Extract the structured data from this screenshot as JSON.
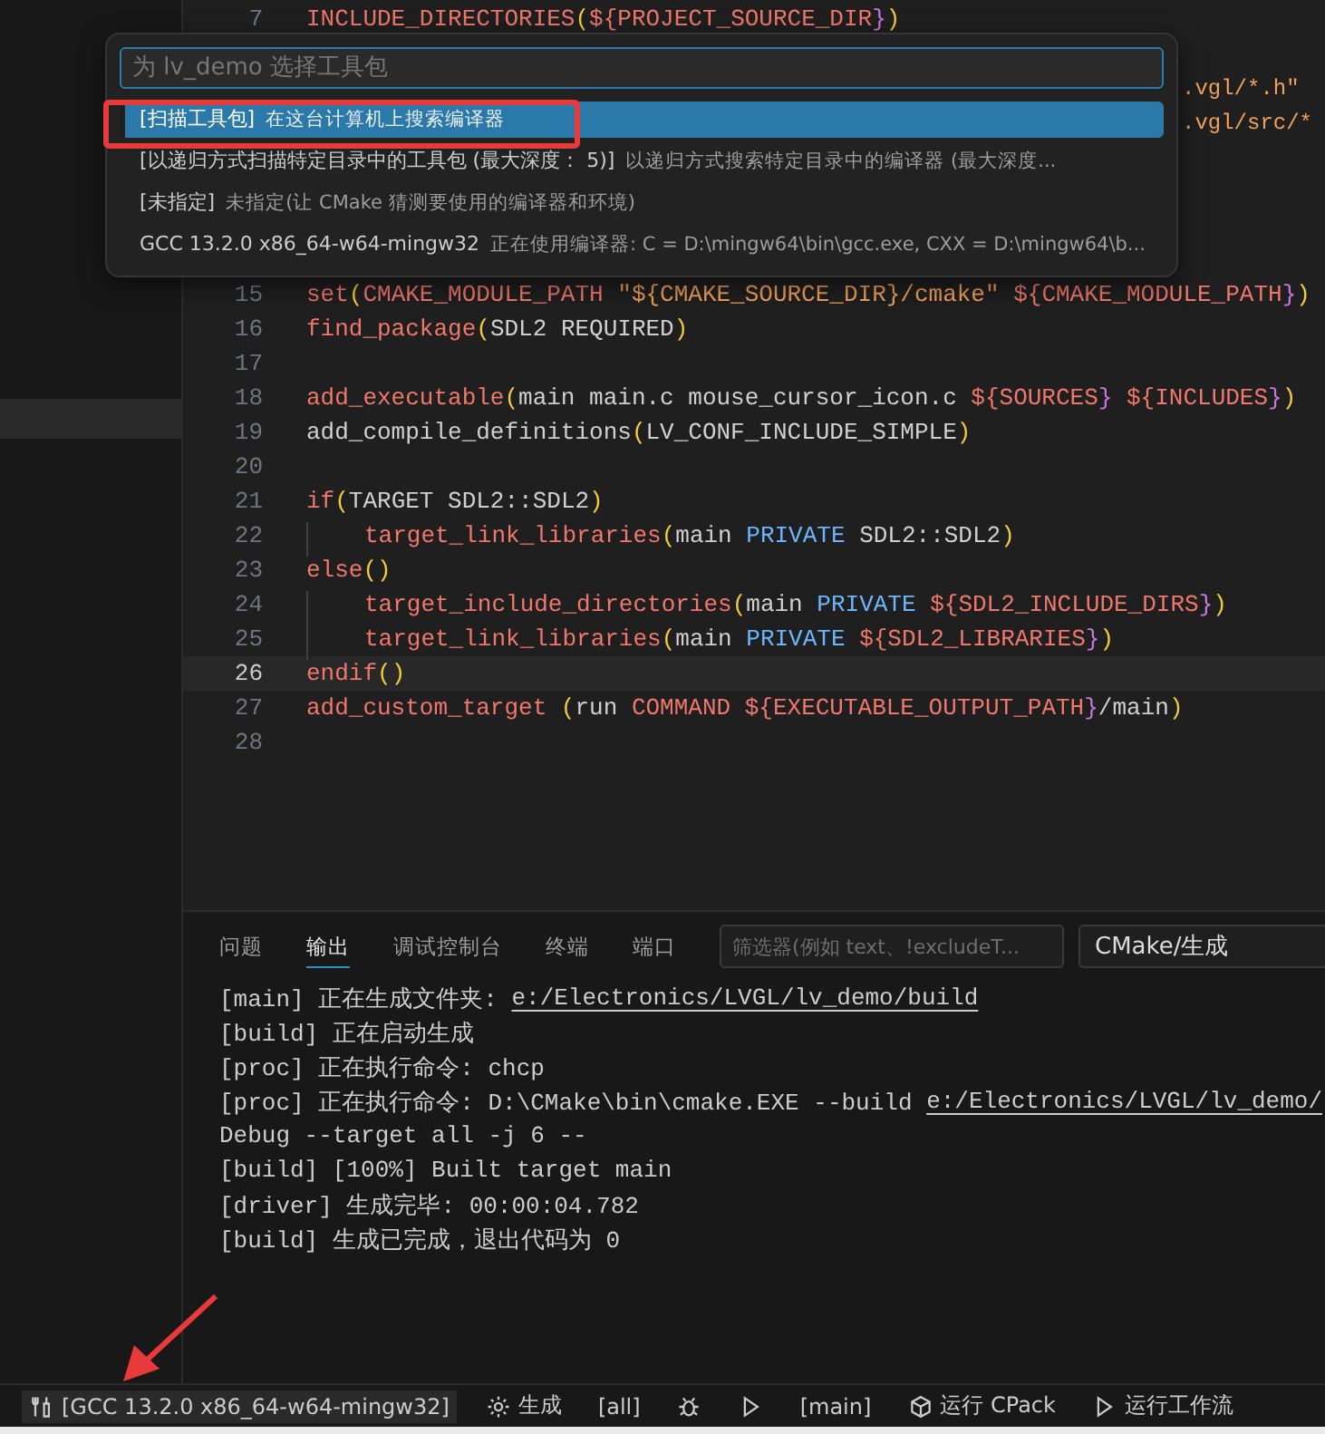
{
  "editor": {
    "lines": [
      {
        "kind": "code",
        "number": "7",
        "current": false,
        "tokens": [
          {
            "kind": "fn",
            "text": "INCLUDE_DIRECTORIES"
          },
          {
            "kind": "paren",
            "text": "("
          },
          {
            "kind": "var",
            "text": "${"
          },
          {
            "kind": "var",
            "text": "PROJECT_SOURCE_DIR"
          },
          {
            "kind": "brace",
            "text": "}"
          },
          {
            "kind": "paren",
            "text": ")"
          }
        ]
      },
      {
        "kind": "covered"
      },
      {
        "kind": "covered",
        "tokens": [
          {
            "kind": "str",
            "text": ".vgl/*.h\""
          }
        ]
      },
      {
        "kind": "covered",
        "tokens": [
          {
            "kind": "str",
            "text": ".vgl/src/*"
          }
        ]
      },
      {
        "kind": "covered"
      },
      {
        "kind": "covered"
      },
      {
        "kind": "covered"
      },
      {
        "kind": "covered"
      },
      {
        "kind": "code",
        "number": "15",
        "current": false,
        "tokens": [
          {
            "kind": "fn",
            "text": "set"
          },
          {
            "kind": "paren",
            "text": "("
          },
          {
            "kind": "fn",
            "text": "CMAKE_MODULE_PATH"
          },
          {
            "kind": "str",
            "text": " \"${CMAKE_SOURCE_DIR}/cmake\""
          },
          {
            "kind": "var",
            "text": " ${"
          },
          {
            "kind": "var",
            "text": "CMAKE_MODULE_PATH"
          },
          {
            "kind": "brace",
            "text": "}"
          },
          {
            "kind": "paren",
            "text": ")"
          }
        ]
      },
      {
        "kind": "code",
        "number": "16",
        "current": false,
        "tokens": [
          {
            "kind": "fn",
            "text": "find_package"
          },
          {
            "kind": "paren",
            "text": "("
          },
          {
            "kind": "plain",
            "text": "SDL2 REQUIRED"
          },
          {
            "kind": "paren",
            "text": ")"
          }
        ]
      },
      {
        "kind": "code",
        "number": "17",
        "current": false
      },
      {
        "kind": "code",
        "number": "18",
        "current": false,
        "tokens": [
          {
            "kind": "fn",
            "text": "add_executable"
          },
          {
            "kind": "paren",
            "text": "("
          },
          {
            "kind": "plain",
            "text": "main main.c mouse_cursor_icon.c "
          },
          {
            "kind": "var",
            "text": "${"
          },
          {
            "kind": "var",
            "text": "SOURCES"
          },
          {
            "kind": "brace",
            "text": "}"
          },
          {
            "kind": "var",
            "text": " ${"
          },
          {
            "kind": "var",
            "text": "INCLUDES"
          },
          {
            "kind": "brace",
            "text": "}"
          },
          {
            "kind": "paren",
            "text": ")"
          }
        ]
      },
      {
        "kind": "code",
        "number": "19",
        "current": false,
        "tokens": [
          {
            "kind": "plain",
            "text": "add_compile_definitions"
          },
          {
            "kind": "paren",
            "text": "("
          },
          {
            "kind": "plain",
            "text": "LV_CONF_INCLUDE_SIMPLE"
          },
          {
            "kind": "paren",
            "text": ")"
          }
        ]
      },
      {
        "kind": "code",
        "number": "20",
        "current": false
      },
      {
        "kind": "code",
        "number": "21",
        "current": false,
        "tokens": [
          {
            "kind": "fn",
            "text": "if"
          },
          {
            "kind": "paren",
            "text": "("
          },
          {
            "kind": "plain",
            "text": "TARGET SDL2::SDL2"
          },
          {
            "kind": "paren",
            "text": ")"
          }
        ]
      },
      {
        "kind": "indented",
        "number": "22",
        "current": false,
        "tokens": [
          {
            "kind": "fn",
            "text": "target_link_libraries"
          },
          {
            "kind": "paren",
            "text": "("
          },
          {
            "kind": "plain",
            "text": "main "
          },
          {
            "kind": "kw",
            "text": "PRIVATE"
          },
          {
            "kind": "plain",
            "text": " SDL2::SDL2"
          },
          {
            "kind": "paren",
            "text": ")"
          }
        ]
      },
      {
        "kind": "code",
        "number": "23",
        "current": false,
        "tokens": [
          {
            "kind": "fn",
            "text": "else"
          },
          {
            "kind": "paren",
            "text": "()"
          }
        ]
      },
      {
        "kind": "indented",
        "number": "24",
        "current": false,
        "tokens": [
          {
            "kind": "fn",
            "text": "target_include_directories"
          },
          {
            "kind": "paren",
            "text": "("
          },
          {
            "kind": "plain",
            "text": "main "
          },
          {
            "kind": "kw",
            "text": "PRIVATE"
          },
          {
            "kind": "var",
            "text": " ${"
          },
          {
            "kind": "var",
            "text": "SDL2_INCLUDE_DIRS"
          },
          {
            "kind": "brace",
            "text": "}"
          },
          {
            "kind": "paren",
            "text": ")"
          }
        ]
      },
      {
        "kind": "indented",
        "number": "25",
        "current": false,
        "tokens": [
          {
            "kind": "fn",
            "text": "target_link_libraries"
          },
          {
            "kind": "paren",
            "text": "("
          },
          {
            "kind": "plain",
            "text": "main "
          },
          {
            "kind": "kw",
            "text": "PRIVATE"
          },
          {
            "kind": "var",
            "text": " ${"
          },
          {
            "kind": "var",
            "text": "SDL2_LIBRARIES"
          },
          {
            "kind": "brace",
            "text": "}"
          },
          {
            "kind": "paren",
            "text": ")"
          }
        ]
      },
      {
        "kind": "code",
        "number": "26",
        "current": true,
        "tokens": [
          {
            "kind": "fn",
            "text": "endif"
          },
          {
            "kind": "paren",
            "text": "()"
          }
        ]
      },
      {
        "kind": "code",
        "number": "27",
        "current": false,
        "tokens": [
          {
            "kind": "fn",
            "text": "add_custom_target"
          },
          {
            "kind": "paren",
            "text": " ("
          },
          {
            "kind": "plain",
            "text": "run "
          },
          {
            "kind": "fn",
            "text": "COMMAND"
          },
          {
            "kind": "var",
            "text": " ${"
          },
          {
            "kind": "var",
            "text": "EXECUTABLE_OUTPUT_PATH"
          },
          {
            "kind": "brace",
            "text": "}"
          },
          {
            "kind": "plain",
            "text": "/main"
          },
          {
            "kind": "paren",
            "text": ")"
          }
        ]
      },
      {
        "kind": "code",
        "number": "28",
        "current": false
      }
    ]
  },
  "quick_pick": {
    "placeholder": "为 lv_demo 选择工具包",
    "items": [
      {
        "label": "[扫描工具包]",
        "description": "在这台计算机上搜索编译器",
        "selected": true
      },
      {
        "label": "[以递归方式扫描特定目录中的工具包 (最大深度： 5)]",
        "description": "以递归方式搜索特定目录中的编译器 (最大深度...",
        "selected": false
      },
      {
        "label": "[未指定]",
        "description": "未指定(让 CMake 猜测要使用的编译器和环境)",
        "selected": false
      },
      {
        "label": "GCC 13.2.0 x86_64-w64-mingw32",
        "description": "正在使用编译器: C = D:\\mingw64\\bin\\gcc.exe, CXX = D:\\mingw64\\b...",
        "selected": false
      }
    ]
  },
  "panel": {
    "tabs": [
      {
        "label": "问题",
        "selected": false
      },
      {
        "label": "输出",
        "selected": true
      },
      {
        "label": "调试控制台",
        "selected": false
      },
      {
        "label": "终端",
        "selected": false
      },
      {
        "label": "端口",
        "selected": false
      }
    ],
    "filter": {
      "placeholder": "筛选器(例如 text、!excludeT..."
    },
    "channel": "CMake/生成",
    "output": [
      [
        {
          "kind": "text",
          "text": "[main] 正在生成文件夹: "
        },
        {
          "kind": "link",
          "text": "e:/Electronics/LVGL/lv_demo/build"
        }
      ],
      [
        {
          "kind": "text",
          "text": "[build] 正在启动生成"
        }
      ],
      [
        {
          "kind": "text",
          "text": "[proc] 正在执行命令: chcp"
        }
      ],
      [
        {
          "kind": "text",
          "text": "[proc] 正在执行命令: D:\\CMake\\bin\\cmake.EXE --build "
        },
        {
          "kind": "link",
          "text": "e:/Electronics/LVGL/lv_demo/"
        }
      ],
      [
        {
          "kind": "text",
          "text": "Debug --target all -j 6 --"
        }
      ],
      [
        {
          "kind": "text",
          "text": "[build] [100%] Built target main"
        }
      ],
      [
        {
          "kind": "text",
          "text": "[driver] 生成完毕: 00:00:04.782"
        }
      ],
      [
        {
          "kind": "text",
          "text": "[build] 生成已完成，退出代码为 0"
        }
      ]
    ]
  },
  "status_bar": {
    "items": [
      {
        "kind": "kit",
        "text": "[GCC 13.2.0 x86_64-w64-mingw32]"
      },
      {
        "kind": "build",
        "text": "生成"
      },
      {
        "kind": "plain",
        "text": "[all]"
      },
      {
        "kind": "debug"
      },
      {
        "kind": "run"
      },
      {
        "kind": "plain",
        "text": "[main]"
      },
      {
        "kind": "cpack",
        "text": "运行 CPack"
      },
      {
        "kind": "workflow",
        "text": "运行工作流"
      }
    ]
  }
}
